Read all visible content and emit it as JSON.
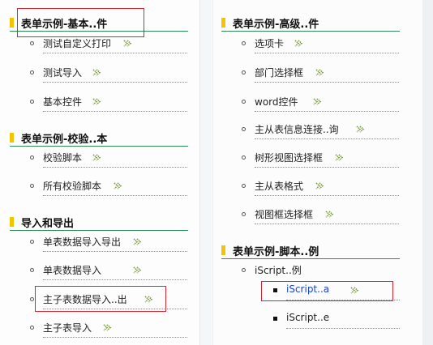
{
  "left": {
    "sections": [
      {
        "title": "表单示例-基本..件",
        "items": [
          "测试自定义打印",
          "测试导入",
          "基本控件"
        ]
      },
      {
        "title": "表单示例-校验..本",
        "items": [
          "校验脚本",
          "所有校验脚本"
        ]
      },
      {
        "title": "导入和导出",
        "items": [
          "单表数据导入导出",
          "单表数据导入",
          "主子表数据导入..出",
          "主子表导入"
        ]
      }
    ]
  },
  "right": {
    "sections": [
      {
        "title": "表单示例-高级..件",
        "items": [
          "选项卡",
          "部门选择框",
          "word控件",
          "主从表信息连接..询",
          "树形视图选择框",
          "主从表格式",
          "视图框选择框"
        ]
      },
      {
        "title": "表单示例-脚本..例",
        "items": [
          "iScript..例"
        ],
        "subitems": [
          "iScript..a",
          "iScript..e"
        ]
      }
    ]
  },
  "colors": {
    "accent_bar": "#f5c400",
    "rule": "#2e8b57",
    "highlight": "#d9252d",
    "arrow": "#7a9a3a"
  }
}
